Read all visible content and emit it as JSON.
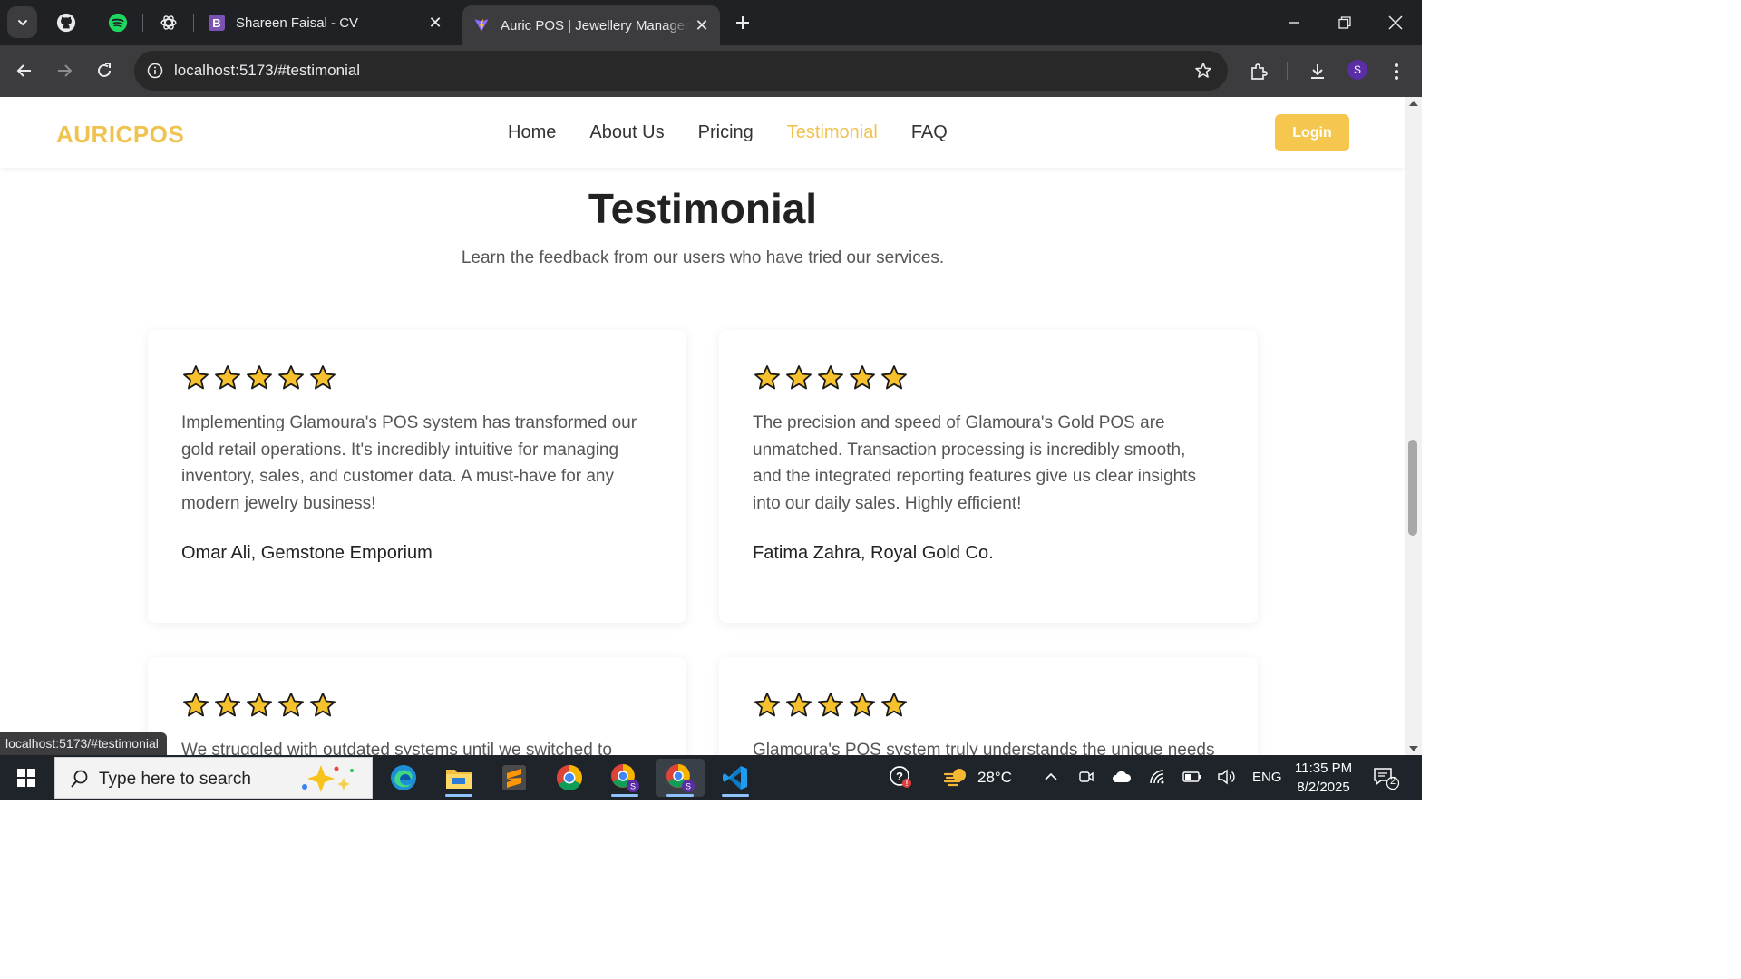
{
  "browser": {
    "tabs": [
      {
        "title": "Shareen Faisal - CV",
        "favicon_letter": "B",
        "favicon_color": "#7952b3"
      },
      {
        "title": "Auric POS | Jewellery Manageme",
        "active": true
      }
    ],
    "url": "localhost:5173/#testimonial",
    "profile_initial": "S",
    "status_url": "localhost:5173/#testimonial"
  },
  "site": {
    "brand": "AURICPOS",
    "nav": [
      "Home",
      "About Us",
      "Pricing",
      "Testimonial",
      "FAQ"
    ],
    "active_nav": "Testimonial",
    "login_label": "Login",
    "accent_color": "#f0c350"
  },
  "section": {
    "title": "Testimonial",
    "subtitle": "Learn the feedback from our users who have tried our services."
  },
  "testimonials": [
    {
      "rating": 5,
      "quote": "Implementing Glamoura's POS system has transformed our gold retail operations. It's incredibly intuitive for managing inventory, sales, and customer data. A must-have for any modern jewelry business!",
      "author": "Omar Ali, Gemstone Emporium"
    },
    {
      "rating": 5,
      "quote": "The precision and speed of Glamoura's Gold POS are unmatched. Transaction processing is incredibly smooth, and the integrated reporting features give us clear insights into our daily sales. Highly efficient!",
      "author": "Fatima Zahra, Royal Gold Co."
    },
    {
      "rating": 5,
      "quote": "We struggled with outdated systems until we switched to",
      "author": ""
    },
    {
      "rating": 5,
      "quote": "Glamoura's POS system truly understands the unique needs of a",
      "author": ""
    }
  ],
  "taskbar": {
    "search_placeholder": "Type here to search",
    "weather": "28°C",
    "language": "ENG",
    "time": "11:35 PM",
    "date": "8/2/2025",
    "notification_count": "2",
    "apps": [
      "edge-icon",
      "file-explorer-icon",
      "sublime-text-icon",
      "chrome-icon",
      "chrome-profile-icon",
      "chrome-profile-active-icon",
      "vscode-icon"
    ]
  }
}
